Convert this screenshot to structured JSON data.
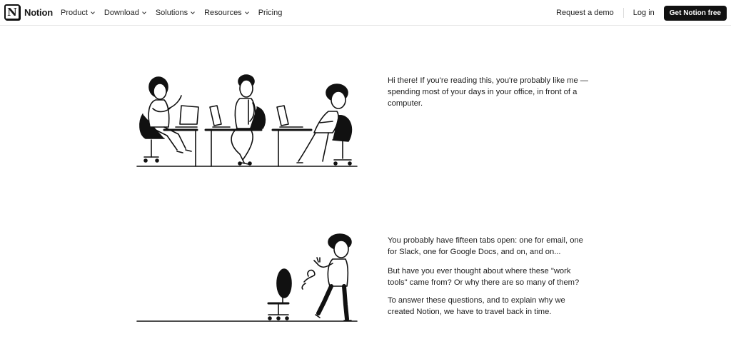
{
  "nav": {
    "logo_letter": "N",
    "brand": "Notion",
    "links": [
      {
        "label": "Product",
        "has_dropdown": true
      },
      {
        "label": "Download",
        "has_dropdown": true
      },
      {
        "label": "Solutions",
        "has_dropdown": true
      },
      {
        "label": "Resources",
        "has_dropdown": true
      },
      {
        "label": "Pricing",
        "has_dropdown": false
      }
    ],
    "request_demo": "Request a demo",
    "login": "Log in",
    "cta": "Get Notion free"
  },
  "content": {
    "section1_text": "Hi there! If you're reading this, you're probably like me —spending most of your days in your office, in front of a computer.",
    "section2_paragraphs": [
      "You probably have fifteen tabs open: one for email, one for Slack, one for Google Docs, and on, and on...",
      "But have you ever thought about where these \"work tools\" came from? Or why there are so many of them?",
      "To answer these questions, and to explain why we created Notion, we have to travel back in time."
    ]
  },
  "icons": {
    "logo": "notion-logo-icon",
    "dropdown": "chevron-down-icon"
  },
  "colors": {
    "cta_bg": "#111111",
    "cta_text": "#ffffff",
    "text": "#191919"
  }
}
